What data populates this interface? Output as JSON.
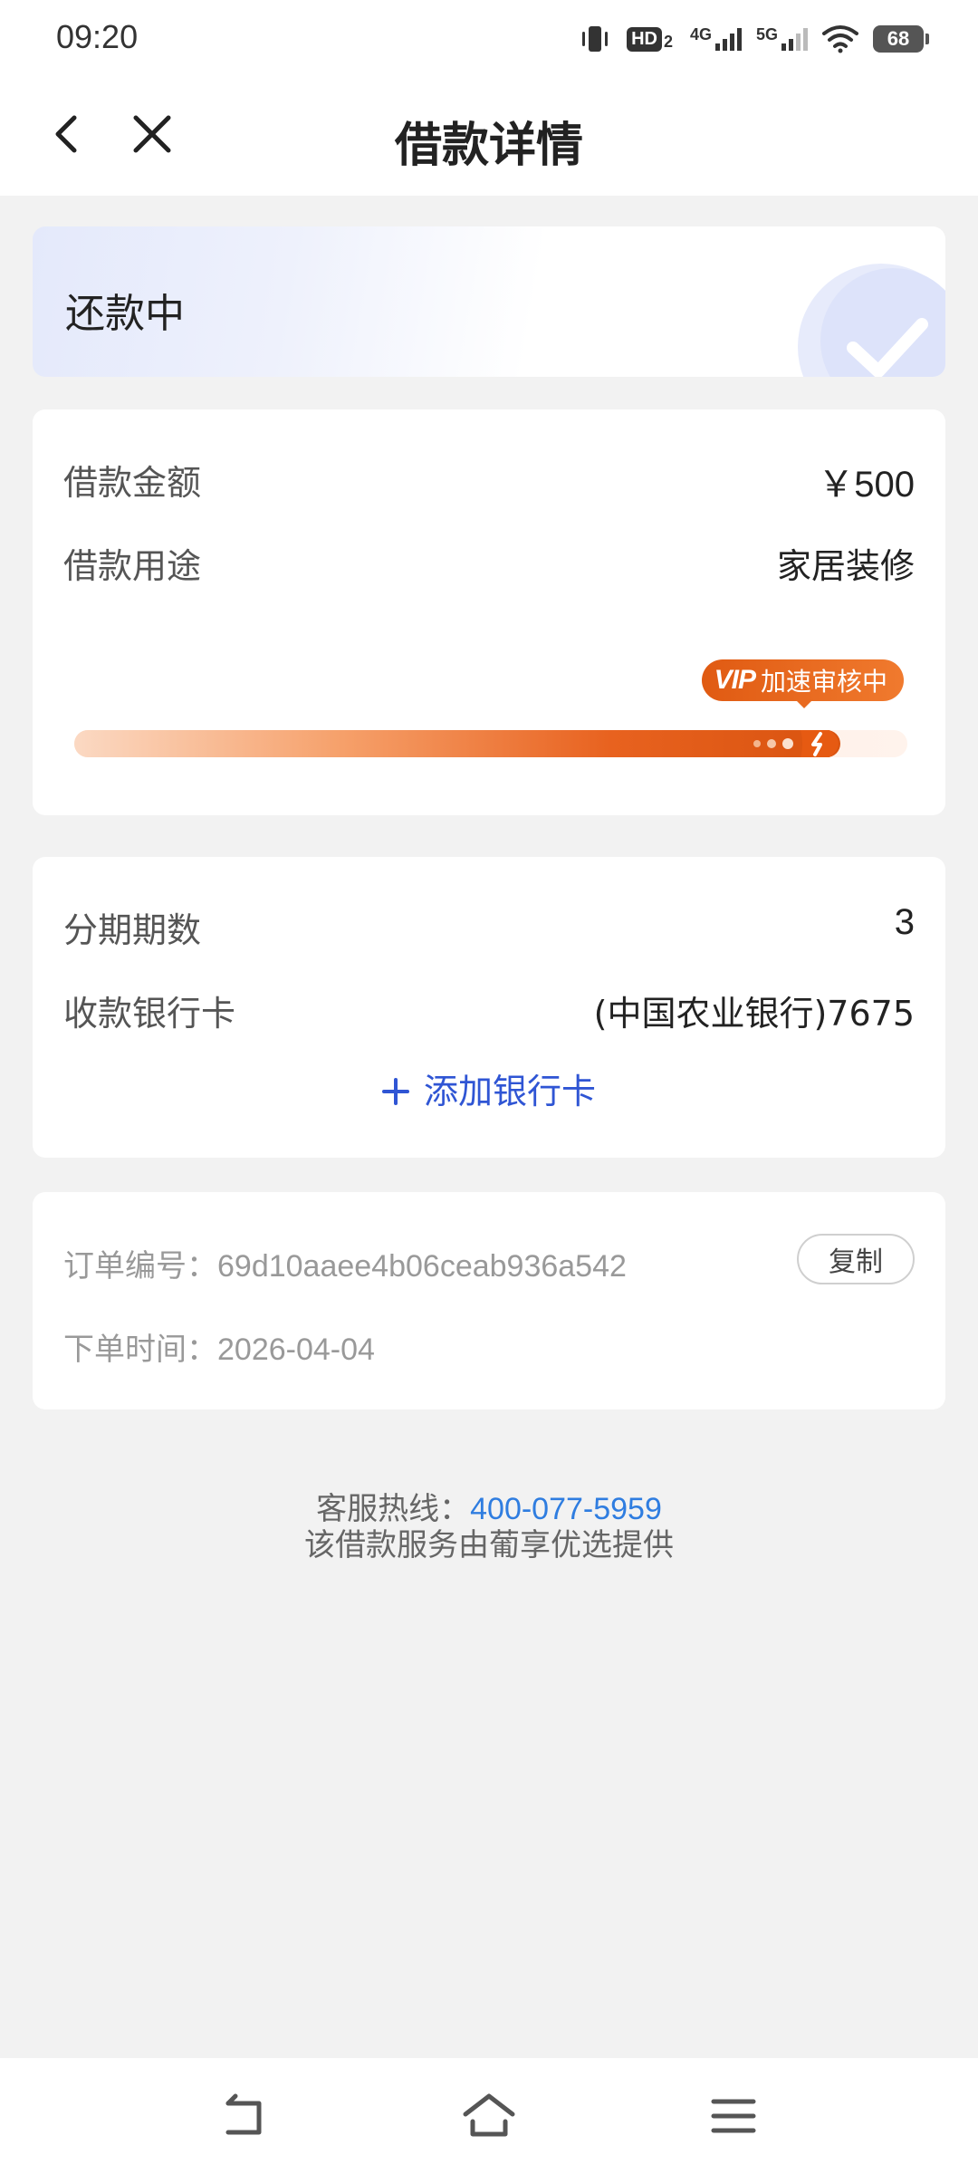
{
  "status_bar": {
    "time": "09:20",
    "hd_badge": "HD",
    "hd_sub": "2",
    "net1": "4G",
    "net2": "5G",
    "battery": "68",
    "icons": [
      "vibrate-icon",
      "hd-icon",
      "signal-4g-icon",
      "signal-5g-icon",
      "wifi-icon",
      "battery-icon"
    ]
  },
  "header": {
    "title": "借款详情",
    "back_icon": "chevron-left-icon",
    "close_icon": "close-icon"
  },
  "status_card": {
    "text": "还款中",
    "icon": "check-badge-icon"
  },
  "loan": {
    "amount_label": "借款金额",
    "amount_value": "￥500",
    "purpose_label": "借款用途",
    "purpose_value": "家居装修",
    "vip_word": "VIP",
    "vip_text": "加速审核中",
    "progress": 0.92,
    "colors": {
      "accent": "#e8621f"
    }
  },
  "installment": {
    "periods_label": "分期期数",
    "periods_value": "3",
    "bank_label": "收款银行卡",
    "bank_value": "(中国农业银行)7675",
    "add_card_label": "添加银行卡"
  },
  "order": {
    "number_label": "订单编号：",
    "number_value": "69d10aaee4b06ceab936a542",
    "copy_label": "复制",
    "time_label": "下单时间：",
    "time_value": "2026-04-04"
  },
  "footer": {
    "hotline_label": "客服热线：",
    "hotline_number": "400-077-5959",
    "provider_text": "该借款服务由葡享优选提供"
  },
  "bottom_nav": {
    "icons": [
      "back-nav-icon",
      "home-icon",
      "menu-icon"
    ]
  }
}
